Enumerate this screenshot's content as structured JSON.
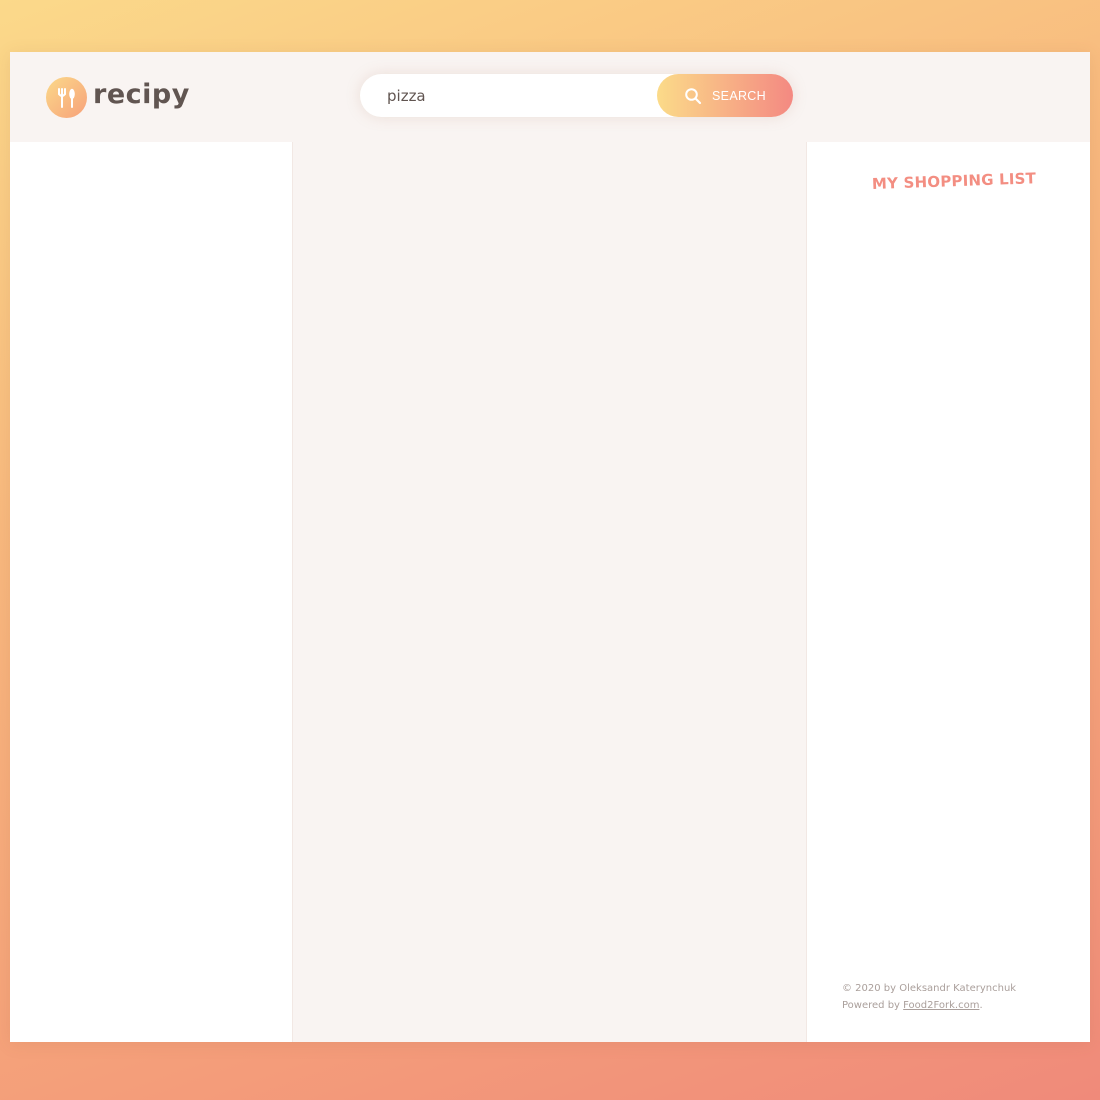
{
  "brand": {
    "name": "recipy",
    "accent_gradient": [
      "#fbdb89",
      "#f48982"
    ],
    "text_color": "#615551"
  },
  "search": {
    "value": "pizza",
    "button_label": "SEARCH",
    "icon": "search-icon"
  },
  "shopping_list": {
    "heading": "MY SHOPPING LIST",
    "heading_color": "#f38e82"
  },
  "footer": {
    "copyright": "© 2020 by Oleksandr Katerynchuk",
    "powered_prefix": "Powered by ",
    "powered_link": "Food2Fork.com",
    "powered_suffix": "."
  }
}
